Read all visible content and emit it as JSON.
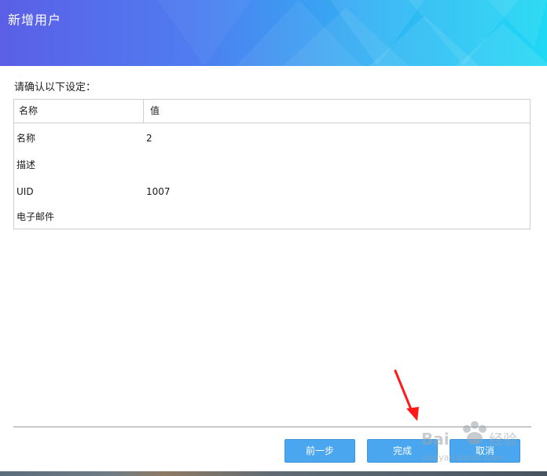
{
  "dialog": {
    "title": "新增用户",
    "prompt": "请确认以下设定："
  },
  "table": {
    "headers": {
      "name": "名称",
      "value": "值"
    },
    "rows": [
      {
        "name": "名称",
        "value": "2"
      },
      {
        "name": "描述",
        "value": ""
      },
      {
        "name": "UID",
        "value": "1007"
      },
      {
        "name": "电子邮件",
        "value": ""
      }
    ]
  },
  "buttons": {
    "prev": "前一步",
    "finish": "完成",
    "cancel": "取消"
  },
  "colors": {
    "button": "#4aa6ee",
    "header_start": "#5b5fe6",
    "header_end": "#20d8f4",
    "annotation_arrow": "#ff1a1a"
  }
}
